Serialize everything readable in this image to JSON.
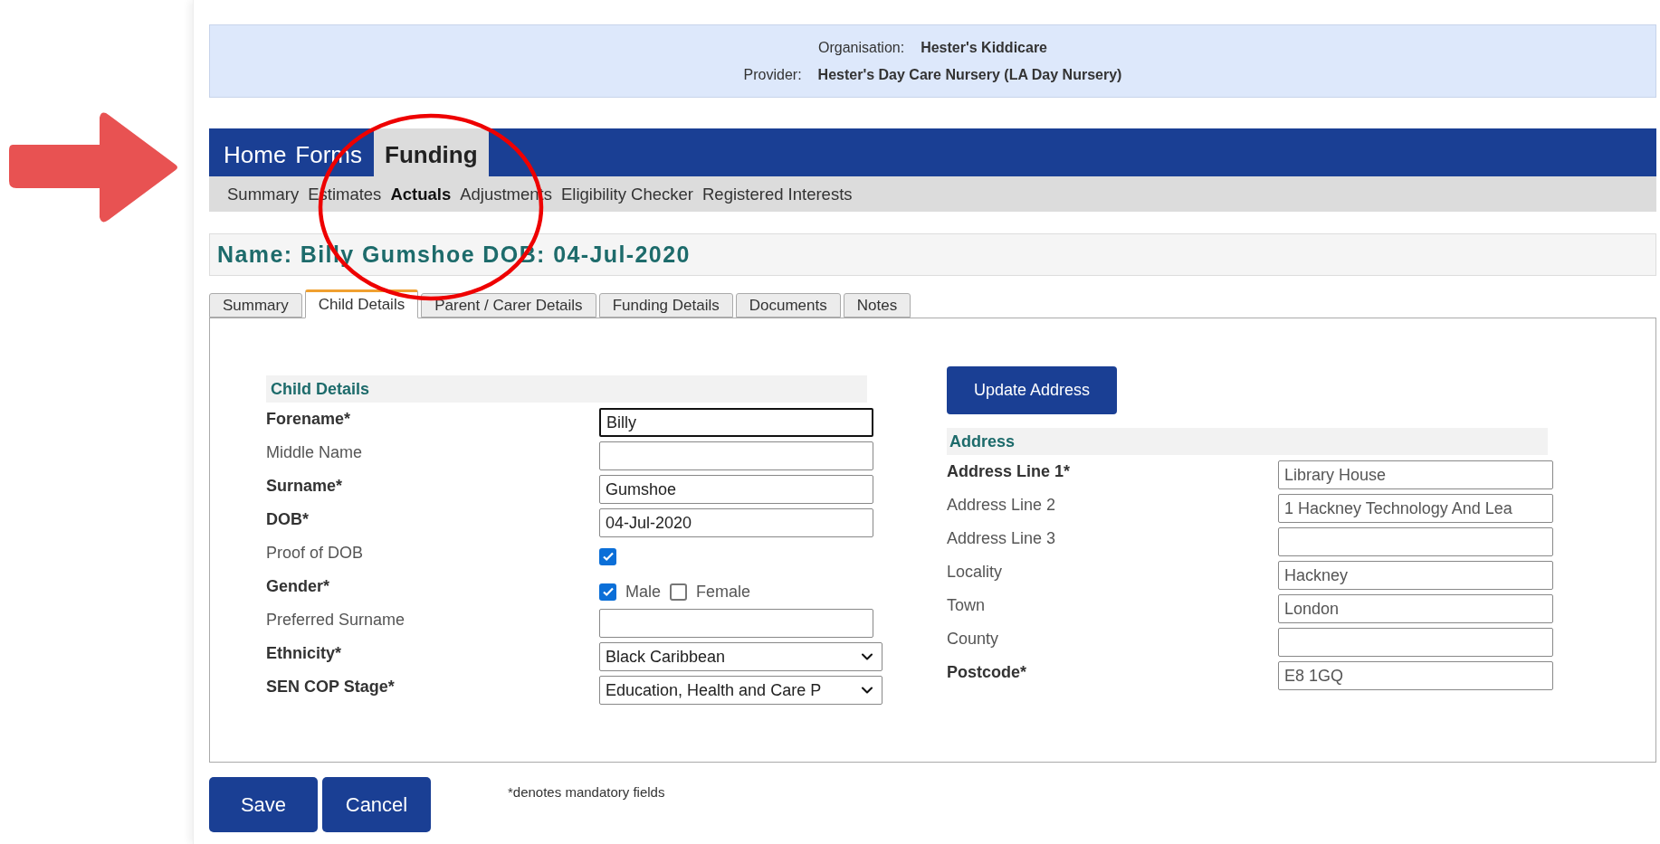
{
  "banner": {
    "rows": [
      {
        "label": "Organisation:",
        "value": "Hester's Kiddicare"
      },
      {
        "label": "Provider:",
        "value": "Hester's Day Care Nursery (LA Day Nursery)"
      }
    ]
  },
  "nav": [
    {
      "label": "Home",
      "selected": false
    },
    {
      "label": "Forms",
      "selected": false
    },
    {
      "label": "Funding",
      "selected": true
    }
  ],
  "subnav": [
    {
      "label": "Summary",
      "selected": false
    },
    {
      "label": "Estimates",
      "selected": false
    },
    {
      "label": "Actuals",
      "selected": true
    },
    {
      "label": "Adjustments",
      "selected": false
    },
    {
      "label": "Eligibility Checker",
      "selected": false
    },
    {
      "label": "Registered Interests",
      "selected": false
    }
  ],
  "name_bar": "Name: Billy Gumshoe DOB: 04-Jul-2020",
  "tabs": [
    {
      "label": "Summary",
      "selected": false
    },
    {
      "label": "Child Details",
      "selected": true
    },
    {
      "label": "Parent / Carer Details",
      "selected": false
    },
    {
      "label": "Funding Details",
      "selected": false
    },
    {
      "label": "Documents",
      "selected": false
    },
    {
      "label": "Notes",
      "selected": false
    }
  ],
  "child_details": {
    "heading": "Child Details",
    "rows": [
      {
        "kind": "text",
        "label": "Forename*",
        "required": true,
        "value": "Billy",
        "focused": true
      },
      {
        "kind": "text",
        "label": "Middle Name",
        "required": false,
        "focused": false
      },
      {
        "kind": "text",
        "label": "Surname*",
        "required": true,
        "value": "Gumshoe",
        "focused": false
      },
      {
        "kind": "text",
        "label": "DOB*",
        "required": true,
        "value": "04-Jul-2020",
        "focused": false
      },
      {
        "kind": "checkbox",
        "label": "Proof of DOB",
        "required": false,
        "checked": true
      },
      {
        "kind": "options",
        "label": "Gender*",
        "required": true,
        "options": [
          {
            "label": "Male",
            "checked": true
          },
          {
            "label": "Female",
            "checked": false
          }
        ]
      },
      {
        "kind": "text",
        "label": "Preferred Surname",
        "required": false,
        "focused": false
      },
      {
        "kind": "select",
        "label": "Ethnicity*",
        "required": true,
        "value": "Black Caribbean"
      },
      {
        "kind": "select",
        "label": "SEN COP Stage*",
        "required": true,
        "value": "Education, Health and Care P"
      }
    ]
  },
  "update_address_button": "Update Address",
  "address": {
    "heading": "Address",
    "rows": [
      {
        "label": "Address Line 1*",
        "required": true,
        "value": "Library House"
      },
      {
        "label": "Address Line 2",
        "required": false,
        "value": "1 Hackney Technology And Lea"
      },
      {
        "label": "Address Line 3",
        "required": false
      },
      {
        "label": "Locality",
        "required": false,
        "value": "Hackney"
      },
      {
        "label": "Town",
        "required": false,
        "value": "London"
      },
      {
        "label": "County",
        "required": false
      },
      {
        "label": "Postcode*",
        "required": true,
        "value": "E8 1GQ"
      }
    ]
  },
  "buttons": [
    "Save",
    "Cancel"
  ],
  "note": "*denotes mandatory fields"
}
